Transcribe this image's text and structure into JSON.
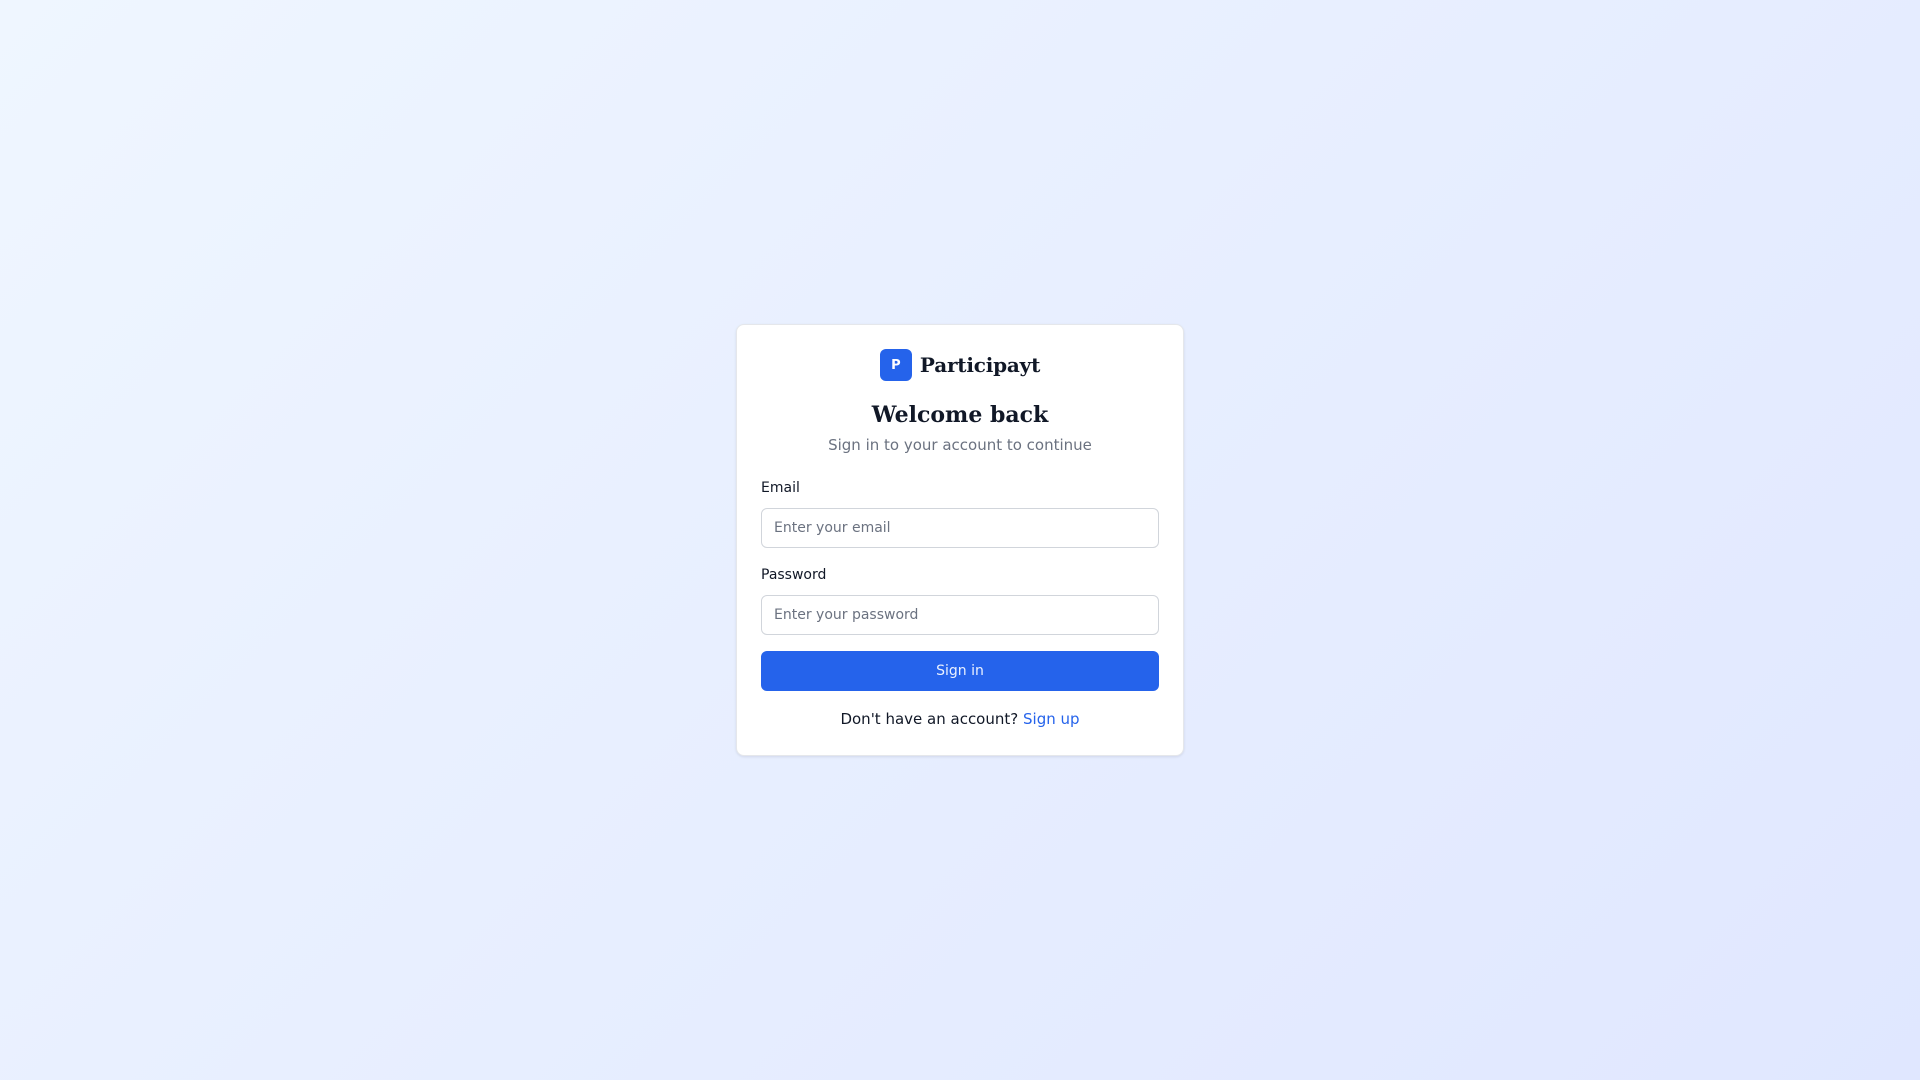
{
  "brand": {
    "badge_letter": "P",
    "name": "Participayt",
    "accent_color": "#2563eb"
  },
  "heading": {
    "title": "Welcome back",
    "subtitle": "Sign in to your account to continue"
  },
  "form": {
    "email": {
      "label": "Email",
      "placeholder": "Enter your email",
      "value": ""
    },
    "password": {
      "label": "Password",
      "placeholder": "Enter your password",
      "value": ""
    },
    "submit_label": "Sign in"
  },
  "footer": {
    "prompt": "Don't have an account?",
    "link_label": "Sign up"
  }
}
